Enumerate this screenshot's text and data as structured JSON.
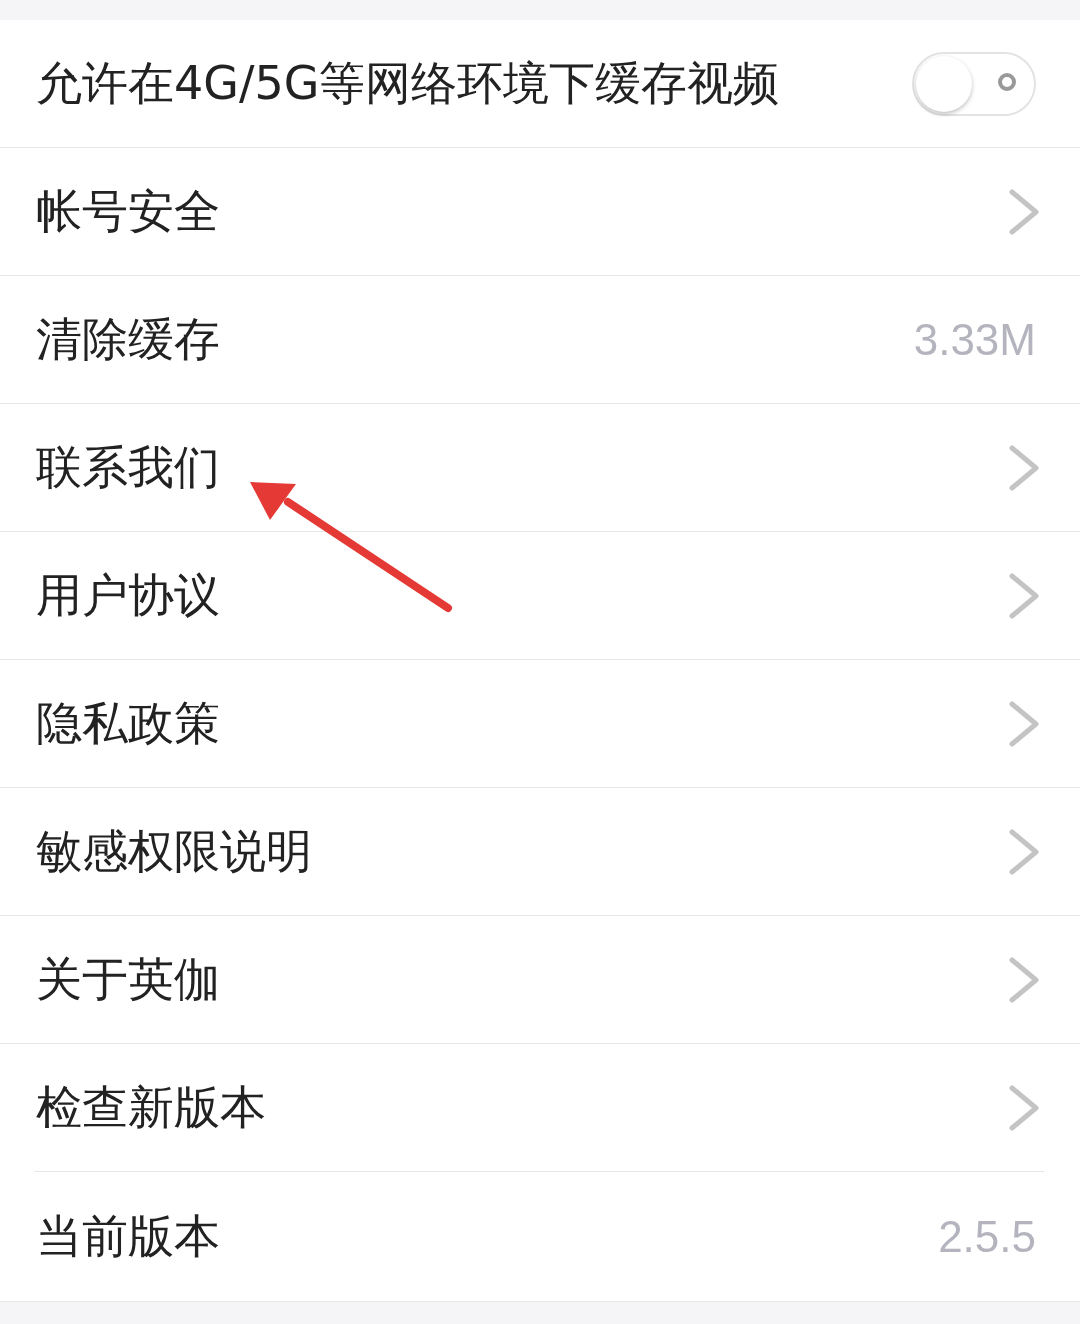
{
  "settings": [
    {
      "kind": "toggle",
      "label": "允许在4G/5G等网络环境下缓存视频",
      "on": false
    },
    {
      "kind": "link",
      "label": "帐号安全"
    },
    {
      "kind": "value",
      "label": "清除缓存",
      "value": "3.33M"
    },
    {
      "kind": "link",
      "label": "联系我们"
    },
    {
      "kind": "link",
      "label": "用户协议"
    },
    {
      "kind": "link",
      "label": "隐私政策"
    },
    {
      "kind": "link",
      "label": "敏感权限说明"
    },
    {
      "kind": "link",
      "label": "关于英伽"
    },
    {
      "kind": "link",
      "label": "检查新版本"
    },
    {
      "kind": "value",
      "label": "当前版本",
      "value": "2.5.5"
    }
  ]
}
